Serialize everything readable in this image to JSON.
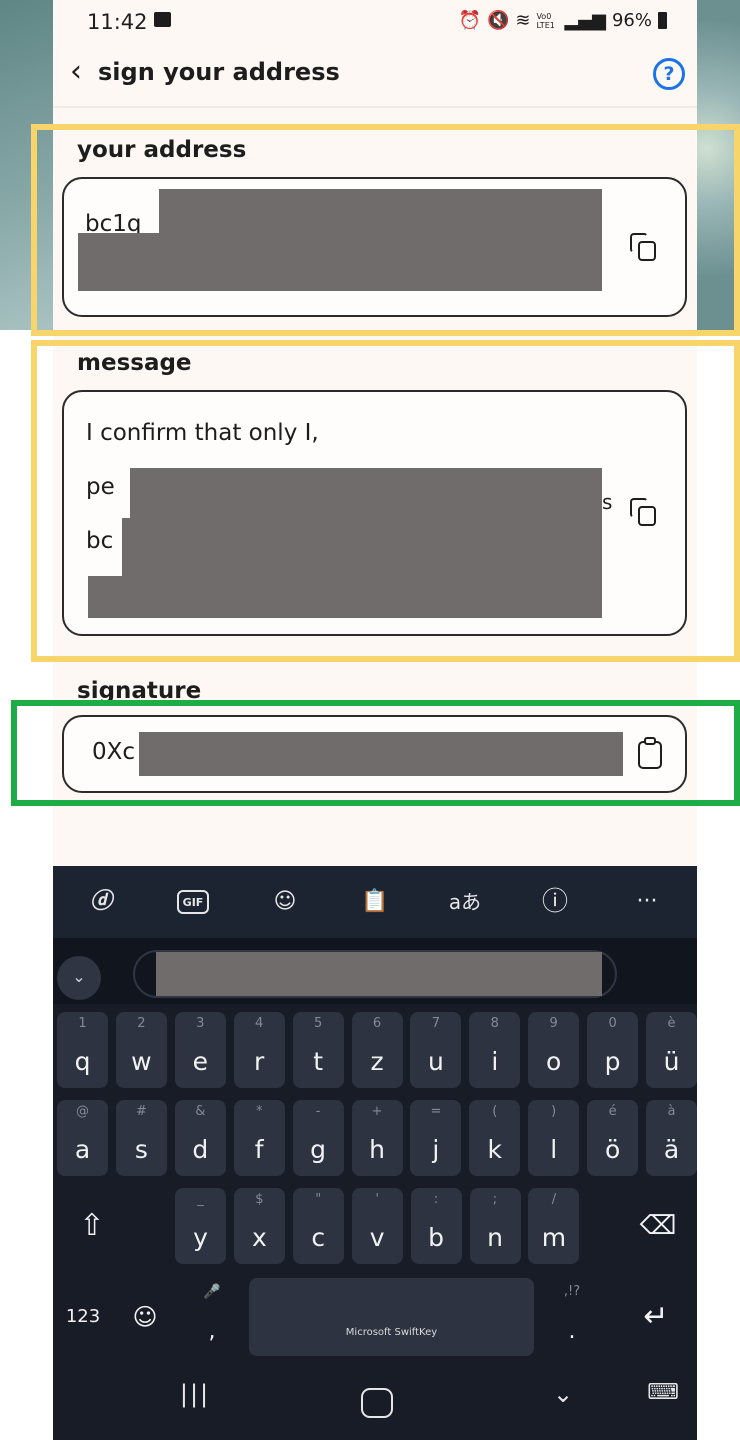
{
  "status_bar": {
    "time": "11:42",
    "right_icons": [
      "alarm-icon",
      "mute-icon",
      "wifi-icon",
      "lte-icon",
      "signal-icon"
    ],
    "lte_label": "Vo0 LTE1",
    "battery": "96%"
  },
  "header": {
    "title": "sign your address",
    "back_icon": "chevron-left-icon",
    "help_icon": "help-icon"
  },
  "address": {
    "label": "your address",
    "value": "bc1q"
  },
  "message": {
    "label": "message",
    "lines": [
      "I confirm that only I,",
      "pe",
      "bc"
    ],
    "trailing_char": "s"
  },
  "signature": {
    "label": "signature",
    "value": "0Xc"
  },
  "highlight_colors": {
    "yellow": "#f8d56a",
    "green": "#1eac47"
  },
  "keyboard": {
    "toolbar": [
      "copilot-icon",
      "GIF",
      "sticker-icon",
      "clipboard-icon",
      "aあ",
      "ⓘ",
      "···"
    ],
    "rows": [
      [
        [
          "q",
          "1"
        ],
        [
          "w",
          "2"
        ],
        [
          "e",
          "3"
        ],
        [
          "r",
          "4"
        ],
        [
          "t",
          "5"
        ],
        [
          "z",
          "6"
        ],
        [
          "u",
          "7"
        ],
        [
          "i",
          "8"
        ],
        [
          "o",
          "9"
        ],
        [
          "p",
          "0"
        ],
        [
          "ü",
          "è"
        ]
      ],
      [
        [
          "a",
          "@"
        ],
        [
          "s",
          "#"
        ],
        [
          "d",
          "&"
        ],
        [
          "f",
          "*"
        ],
        [
          "g",
          "-"
        ],
        [
          "h",
          "+"
        ],
        [
          "j",
          "="
        ],
        [
          "k",
          "("
        ],
        [
          "l",
          ")"
        ],
        [
          "ö",
          "é"
        ],
        [
          "ä",
          "à"
        ]
      ],
      [
        [
          "y",
          "_"
        ],
        [
          "x",
          "$"
        ],
        [
          "c",
          "\""
        ],
        [
          "v",
          "'"
        ],
        [
          "b",
          ":"
        ],
        [
          "n",
          ";"
        ],
        [
          "m",
          "/"
        ]
      ]
    ],
    "numbers_label": "123",
    "comma": ",",
    "period": ".",
    "period_hint": ",!?",
    "space_label": "Microsoft SwiftKey"
  }
}
